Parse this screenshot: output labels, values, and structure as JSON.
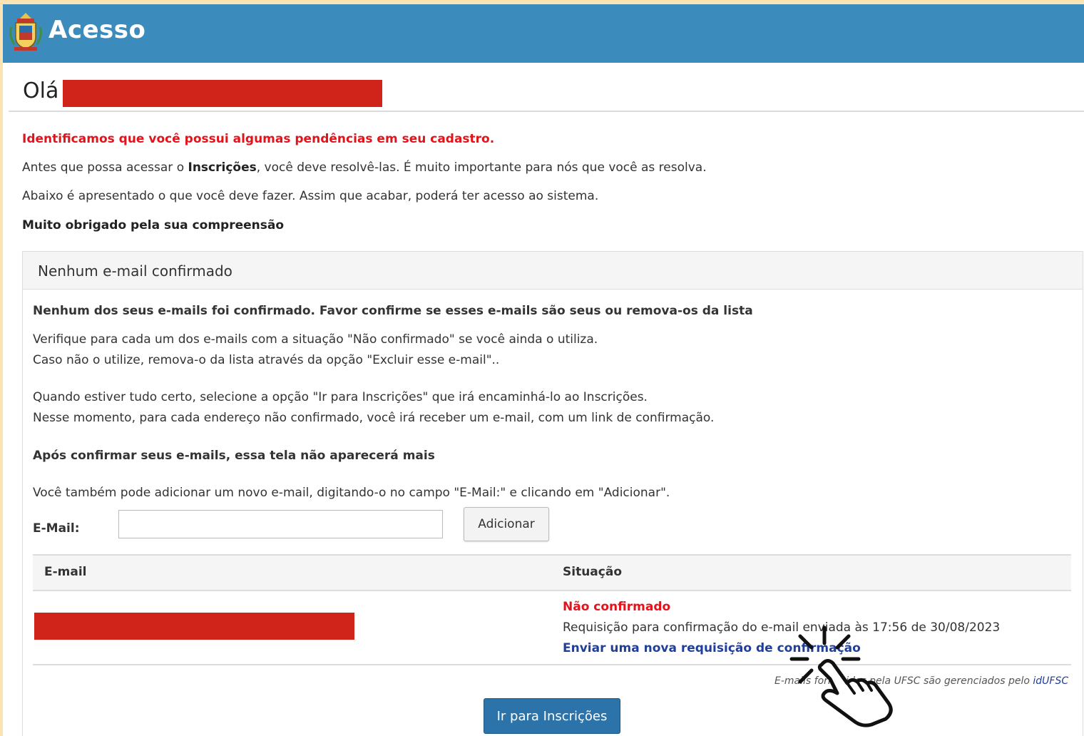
{
  "header": {
    "title": "Acesso",
    "logo_icon": "ufsc-coat-of-arms-icon",
    "bg_color": "#3b8bbd"
  },
  "greeting": {
    "text": "Olá"
  },
  "notice": {
    "alert": "Identificamos que você possui algumas pendências em seu cadastro.",
    "line1_prefix": "Antes que possa acessar o ",
    "line1_bold": "Inscrições",
    "line1_suffix": ", você deve resolvê-las. É muito importante para nós que você as resolva.",
    "line2": "Abaixo é apresentado o que você deve fazer. Assim que acabar, poderá ter acesso ao sistema.",
    "thanks": "Muito obrigado pela sua compreensão"
  },
  "panel": {
    "title": "Nenhum e-mail confirmado",
    "heading": "Nenhum dos seus e-mails foi confirmado. Favor confirme se esses e-mails são seus ou remova-os da lista",
    "p1": "Verifique para cada um dos e-mails com a situação \"Não confirmado\" se você ainda o utiliza.",
    "p2": "Caso não o utilize, remova-o da lista através da opção \"Excluir esse e-mail\"..",
    "p3": "Quando estiver tudo certo, selecione a opção \"Ir para Inscrições\" que irá encaminhá-lo ao Inscrições.",
    "p4": "Nesse momento, para cada endereço não confirmado, você irá receber um e-mail, com um link de confirmação.",
    "after_confirm": "Após confirmar seus e-mails, essa tela não aparecerá mais",
    "add_hint": "Você também pode adicionar um novo e-mail, digitando-o no campo \"E-Mail:\" e clicando em \"Adicionar\".",
    "email_label": "E-Mail:",
    "email_value": "",
    "add_button": "Adicionar"
  },
  "table": {
    "columns": [
      "E-mail",
      "Situação"
    ],
    "rows": [
      {
        "status": "Não confirmado",
        "request": "Requisição para confirmação do e-mail enviada às 17:56 de 30/08/2023",
        "resend": "Enviar uma nova requisição de confirmação"
      }
    ]
  },
  "footnote": {
    "prefix": "E-mails fornecidos pela UFSC são gerenciados pelo ",
    "link": "idUFSC"
  },
  "primary_button": "Ir para Inscrições",
  "colors": {
    "alert": "#e3131b",
    "link": "#1f3f9a",
    "redaction": "#d0241b",
    "primary": "#2c73aa"
  }
}
